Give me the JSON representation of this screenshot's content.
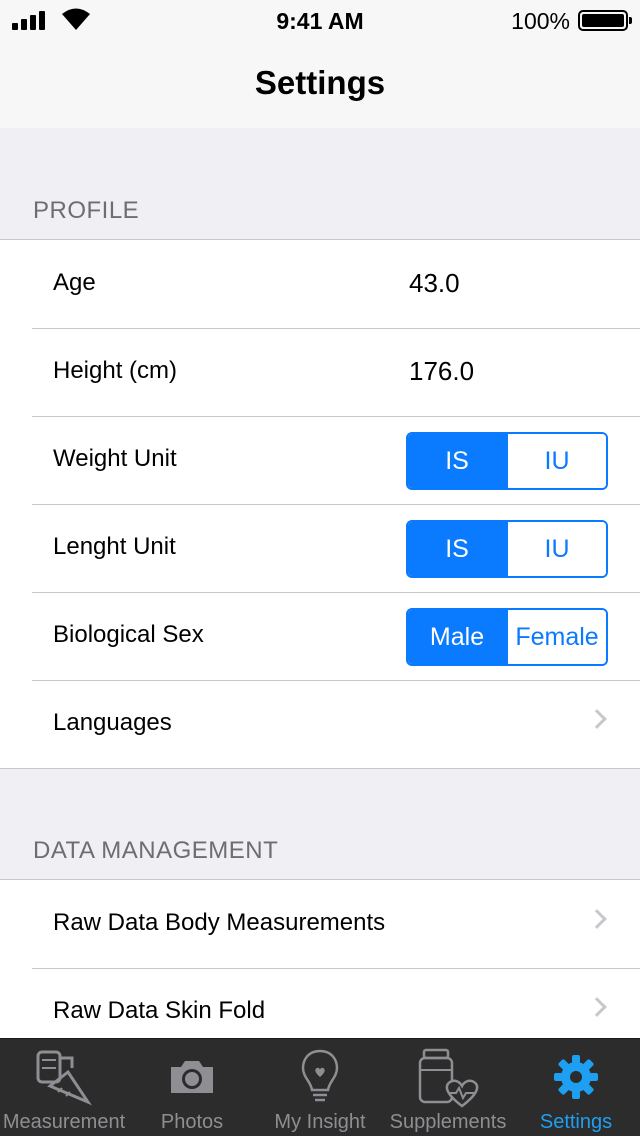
{
  "status": {
    "time": "9:41 AM",
    "battery": "100%"
  },
  "nav": {
    "title": "Settings"
  },
  "profile": {
    "header": "PROFILE",
    "age_label": "Age",
    "age_value": "43.0",
    "height_label": "Height (cm)",
    "height_value": "176.0",
    "weight_label": "Weight Unit",
    "weight_options": [
      "IS",
      "IU"
    ],
    "weight_selected": "IS",
    "length_label": "Lenght Unit",
    "length_options": [
      "IS",
      "IU"
    ],
    "length_selected": "IS",
    "sex_label": "Biological Sex",
    "sex_options": [
      "Male",
      "Female"
    ],
    "sex_selected": "Male",
    "languages_label": "Languages"
  },
  "data_management": {
    "header": "DATA MANAGEMENT",
    "items": [
      {
        "label": "Raw Data Body Measurements"
      },
      {
        "label": "Raw Data Skin Fold"
      }
    ]
  },
  "tabs": [
    {
      "label": "Measurement",
      "icon": "measuring-tape-icon"
    },
    {
      "label": "Photos",
      "icon": "camera-icon"
    },
    {
      "label": "My Insight",
      "icon": "lightbulb-icon"
    },
    {
      "label": "Supplements",
      "icon": "supplements-heart-icon"
    },
    {
      "label": "Settings",
      "icon": "gear-icon",
      "selected": true
    }
  ],
  "colors": {
    "accent": "#0a7aff",
    "tab_selected": "#1e9ff2",
    "tab_bar": "#2c2c2c",
    "background": "#efeff4"
  }
}
